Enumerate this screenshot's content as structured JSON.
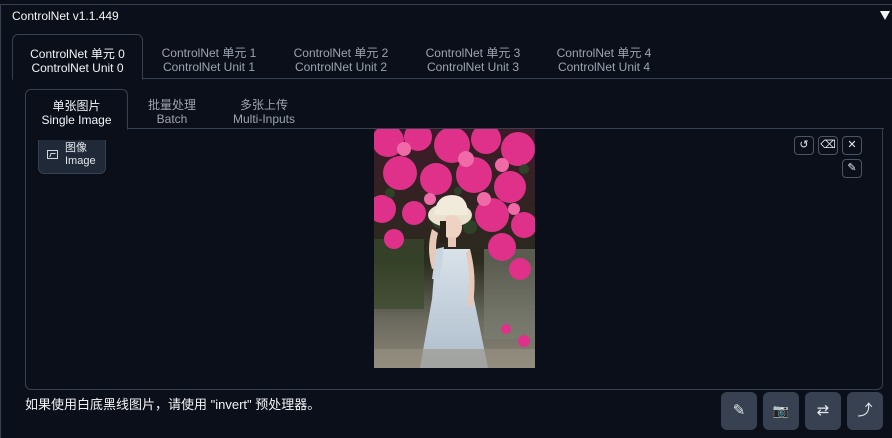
{
  "header": {
    "title": "ControlNet v1.1.449",
    "collapse_icon": "triangle-down-icon"
  },
  "unit_tabs": [
    {
      "line1": "ControlNet 单元 0",
      "line2": "ControlNet Unit 0",
      "active": true
    },
    {
      "line1": "ControlNet 单元 1",
      "line2": "ControlNet Unit 1",
      "active": false
    },
    {
      "line1": "ControlNet 单元 2",
      "line2": "ControlNet Unit 2",
      "active": false
    },
    {
      "line1": "ControlNet 单元 3",
      "line2": "ControlNet Unit 3",
      "active": false
    },
    {
      "line1": "ControlNet 单元 4",
      "line2": "ControlNet Unit 4",
      "active": false
    }
  ],
  "image_tabs": [
    {
      "line1": "单张图片",
      "line2": "Single Image",
      "active": true
    },
    {
      "line1": "批量处理",
      "line2": "Batch",
      "active": false
    },
    {
      "line1": "多张上传",
      "line2": "Multi-Inputs",
      "active": false
    }
  ],
  "image_panel": {
    "label_cn": "图像",
    "label_en": "Image",
    "tools": [
      "undo-icon",
      "eraser-icon",
      "close-icon",
      "brush-icon"
    ],
    "tool_glyphs": {
      "undo": "↺",
      "eraser": "⌫",
      "close": "✕",
      "brush": "✎"
    }
  },
  "hint": "如果使用白底黑线图片，请使用 \"invert\" 预处理器。",
  "actions": [
    {
      "name": "open-editor-icon",
      "glyph": "✎"
    },
    {
      "name": "camera-icon",
      "glyph": "📷"
    },
    {
      "name": "swap-icon",
      "glyph": "⇄"
    },
    {
      "name": "send-dimensions-icon",
      "glyph": "⤴"
    }
  ],
  "colors": {
    "background": "#0b0f19",
    "border": "#374151",
    "button": "#374151",
    "flowers": "#e0318a"
  }
}
